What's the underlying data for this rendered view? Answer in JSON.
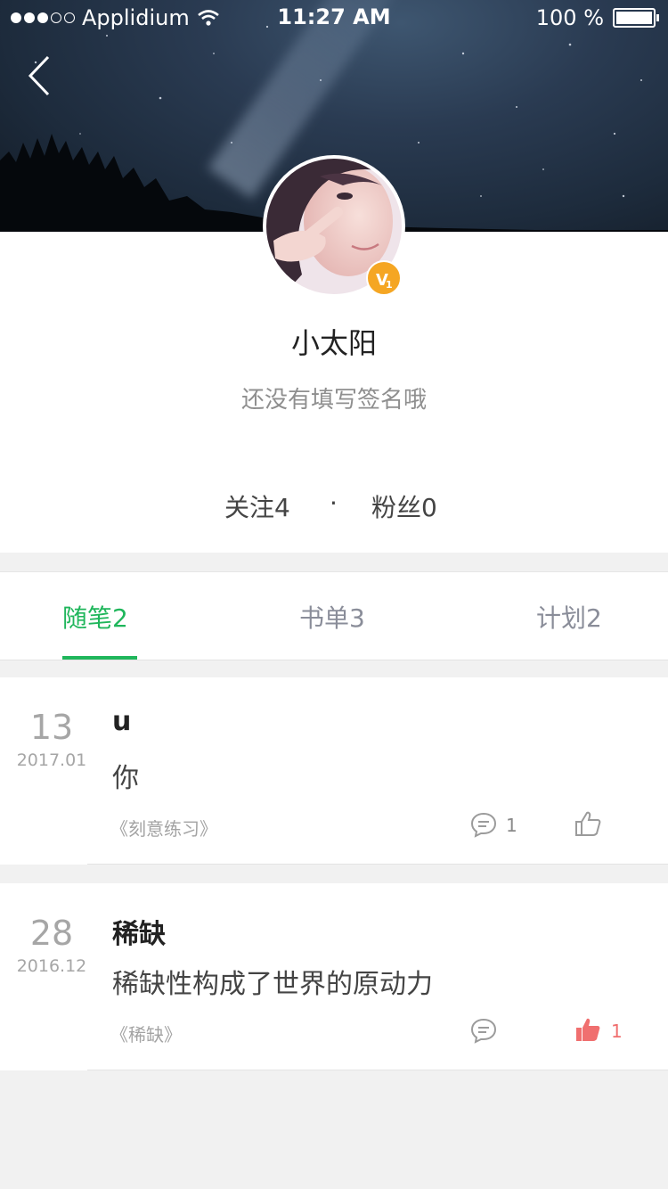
{
  "status_bar": {
    "carrier": "Applidium",
    "time": "11:27 AM",
    "battery": "100 %"
  },
  "profile": {
    "name": "小太阳",
    "signature": "还没有填写签名哦",
    "follow_label": "关注4",
    "separator": "·",
    "fans_label": "粉丝0",
    "badge_icon": "level-badge-icon",
    "colors": {
      "badge": "#f5a623"
    }
  },
  "tabs": [
    {
      "label": "随笔2",
      "active": true
    },
    {
      "label": "书单3",
      "active": false
    },
    {
      "label": "计划2",
      "active": false
    }
  ],
  "colors": {
    "accent": "#1fb65b",
    "liked": "#f06f6f"
  },
  "posts": [
    {
      "day": "13",
      "year_month": "2017.01",
      "title": "u",
      "body": "你",
      "book": "《刻意练习》",
      "comment_count": "1",
      "like_count": "",
      "liked": false
    },
    {
      "day": "28",
      "year_month": "2016.12",
      "title": "稀缺",
      "body": "稀缺性构成了世界的原动力",
      "book": "《稀缺》",
      "comment_count": "",
      "like_count": "1",
      "liked": true
    }
  ]
}
